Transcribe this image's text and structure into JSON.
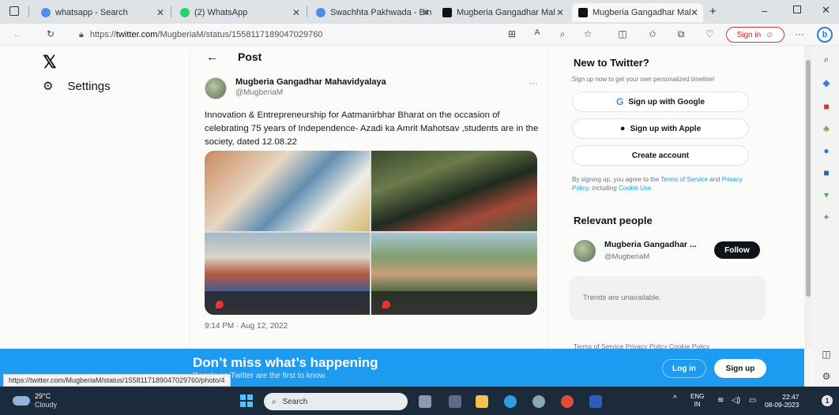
{
  "browser": {
    "tabs": [
      {
        "label": "whatsapp - Search",
        "color": "#4b8fe8"
      },
      {
        "label": "(2) WhatsApp",
        "color": "#25d366"
      },
      {
        "label": "Swachhta Pakhwada - Bin",
        "color": "#4b8fe8"
      },
      {
        "label": "Mugberia Gangadhar Mal",
        "color": "#111111"
      },
      {
        "label": "Mugberia Gangadhar Mal",
        "color": "#111111"
      }
    ],
    "url_prefix": "https://",
    "url_host": "twitter.com",
    "url_path": "/MugberiaM/status/1558117189047029760",
    "signin_label": "Sign in",
    "status_url": "https://twitter.com/MugberiaM/status/1558117189047029760/photo/4"
  },
  "nav": {
    "logo": "𝕏",
    "settings_label": "Settings"
  },
  "post": {
    "header": "Post",
    "author_name": "Mugberia Gangadhar Mahavidyalaya",
    "author_handle": "@MugberiaM",
    "more": "···",
    "text": "Innovation & Entrepreneurship for Aatmanirbhar Bharat  on the occasion of celebrating 75 years of Independence-  Azadi ka Amrit Mahotsav ,students are in the society, dated 12.08.22",
    "timestamp": "9:14 PM · Aug 12, 2022"
  },
  "sidebar": {
    "new_title": "New to Twitter?",
    "new_sub": "Sign up now to get your own personalized timeline!",
    "google_btn": "Sign up with Google",
    "apple_btn": "Sign up with Apple",
    "create_btn": "Create account",
    "terms_pre": "By signing up, you agree to the ",
    "terms_tos": "Terms of Service",
    "terms_and": " and ",
    "terms_pp": "Privacy Policy",
    "terms_inc": ", including ",
    "terms_cookie": "Cookie Use",
    "relevant_title": "Relevant people",
    "rel_name": "Mugberia Gangadhar ...",
    "rel_handle": "@MugberiaM",
    "follow_btn": "Follow",
    "trends_text": "Trends are unavailable.",
    "footer_links": "Terms of Service   Privacy Policy   Cookie Policy"
  },
  "banner": {
    "title": "Don’t miss what’s happening",
    "subtitle": "People on Twitter are the first to know.",
    "login_btn": "Log in",
    "signup_btn": "Sign up"
  },
  "taskbar": {
    "temp": "29°C",
    "weather": "Cloudy",
    "search_placeholder": "Search",
    "lang_top": "ENG",
    "lang_bottom": "IN",
    "time": "22:47",
    "date": "08-09-2023"
  },
  "colors": {
    "twitter_blue": "#1d9bf0",
    "taskbar": "#1c2b3c"
  }
}
